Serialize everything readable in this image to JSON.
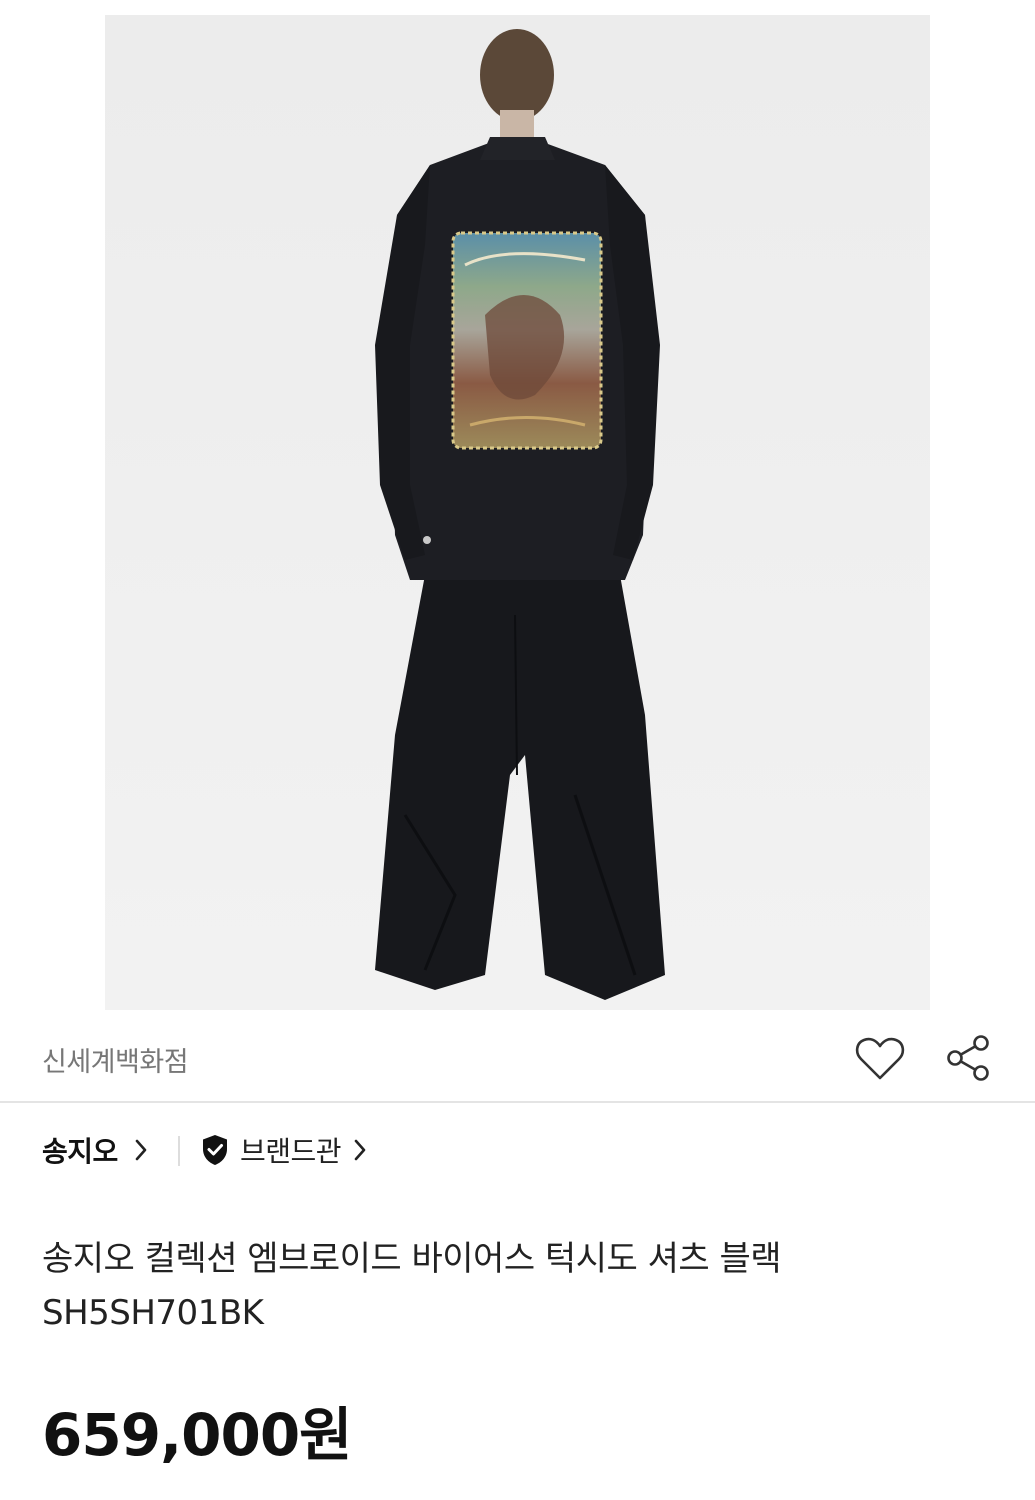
{
  "product": {
    "image_alt": "model wearing black oversized shirt with embroidered back panel and wide black trousers",
    "seller": "신세계백화점",
    "brand": "송지오",
    "brand_hall_label": "브랜드관",
    "title": "송지오 컬렉션 엠브로이드 바이어스 턱시도 셔츠 블랙 SH5SH701BK",
    "price": "659,000원"
  },
  "icons": {
    "wish": "heart-outline-icon",
    "share": "share-icon",
    "brand_chevron": "chevron-right-icon",
    "verified": "verified-shield-icon"
  },
  "colors": {
    "image_bg": "#efefef",
    "garment": "#1b1c20",
    "text_primary": "#111111",
    "text_secondary": "#777777",
    "divider": "#e4e4e4"
  }
}
